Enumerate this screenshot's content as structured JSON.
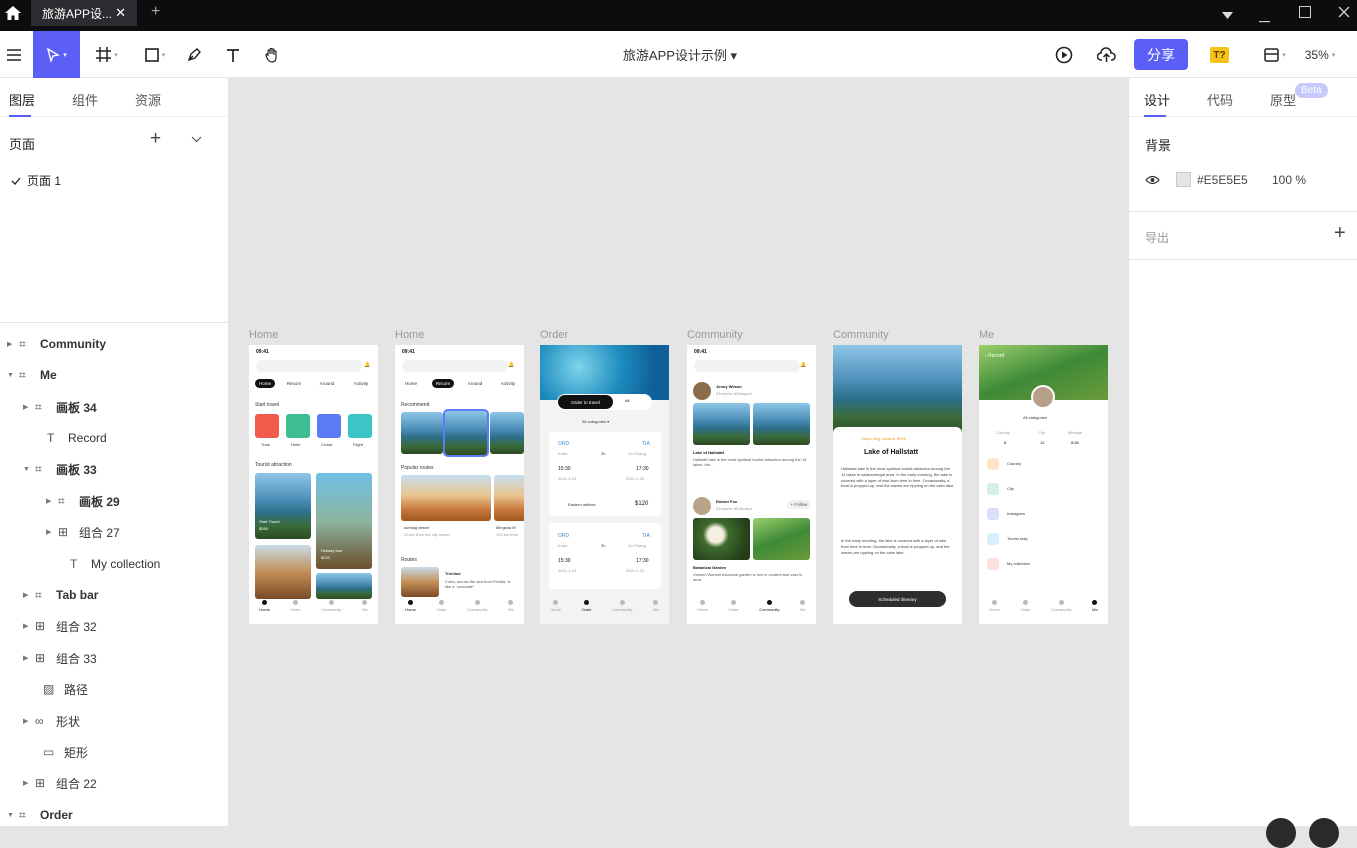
{
  "titlebar": {
    "tab_title": "旅游APP设...",
    "close": "✕",
    "new_tab": "+"
  },
  "toolbar": {
    "doc_title": "旅游APP设计示例 ▾",
    "share": "分享",
    "plugin": "T?",
    "zoom": "35%"
  },
  "left": {
    "tabs": [
      "图层",
      "组件",
      "资源"
    ],
    "pages_title": "页面",
    "page_item": "页面 1",
    "layers": [
      {
        "label": "Community",
        "bold": true
      },
      {
        "label": "Me",
        "bold": true
      },
      {
        "label": "画板 34",
        "bold": true
      },
      {
        "label": "Record",
        "bold": false
      },
      {
        "label": "画板 33",
        "bold": true
      },
      {
        "label": "画板 29",
        "bold": true
      },
      {
        "label": "组合 27",
        "bold": false
      },
      {
        "label": "My collection",
        "bold": false
      },
      {
        "label": "Tab bar",
        "bold": true
      },
      {
        "label": "组合 32",
        "bold": false
      },
      {
        "label": "组合 33",
        "bold": false
      },
      {
        "label": "路径",
        "bold": false
      },
      {
        "label": "形状",
        "bold": false
      },
      {
        "label": "矩形",
        "bold": false
      },
      {
        "label": "组合 22",
        "bold": false
      },
      {
        "label": "Order",
        "bold": true
      }
    ]
  },
  "right": {
    "tabs": [
      "设计",
      "代码",
      "原型"
    ],
    "beta": "Beta",
    "background_title": "背景",
    "bg_hex": "#E5E5E5",
    "bg_opacity": "100 %",
    "export_title": "导出"
  },
  "frames": {
    "labels": [
      "Home",
      "Home",
      "Order",
      "Community",
      "Community",
      "Me"
    ],
    "time": "09:41",
    "home1": {
      "chips": [
        "Home",
        "Recom",
        "Around",
        "Activity"
      ],
      "start_travel": "Start travel",
      "modes": [
        "Train",
        "Hotel",
        "Cruise",
        "Flight"
      ],
      "tourist_attraction": "Tourist attraction",
      "card1": "Start Travel",
      "card1_price": "$260",
      "card2": "Holiday tour",
      "card2_price": "$220"
    },
    "home2": {
      "chips": [
        "Home",
        "Recom",
        "Around",
        "Activity"
      ],
      "recommend": "Recommend",
      "popular_routes": "Popular routes",
      "route1": "kumtag desert",
      "route1_sub": "20 km from the city center",
      "route2": "Mingsha M",
      "route2_sub": "100 km from",
      "routes": "Routes",
      "trinidad": "Trinidad",
      "trinidad_desc": "Cuba, across the sea from Florida, is like a \"crocodile\""
    },
    "order": {
      "tab_active": "Order to travel",
      "tab_all": "All",
      "categories": "All categories ▾",
      "from": "ORD",
      "to": "TIA",
      "from_city": "Krabi",
      "to_city": "Xo Chang",
      "dur": "2h",
      "dep": "15:30",
      "arr": "17:30",
      "date": "2021-2-23",
      "airline": "Eastern airlines",
      "price": "$120"
    },
    "community1": {
      "user1": "Jenny Wilson",
      "user1_tag": "#Traveler #Designer",
      "post1_title": "Lake of Hallstatt",
      "post1_desc": "Hallstatt lake is the most spiritual tourist attraction among the 14 lakes, the...",
      "user2": "Robert Fox",
      "user2_tag": "#Traveler #Educator",
      "follow": "+ Follow",
      "post2_title": "Botanical Garden",
      "post2_desc": "Xiamen Wanshi botanical garden is rich in content and vast in area."
    },
    "community2": {
      "tag": "7days long. Austria. $999",
      "title": "Lake of Hallstatt",
      "p1": "Hallstadt lake is the most spiritual tourist attraction among the 14 lakes in salzkamergut area. In the early morning, the lake is covered with a layer of mist from time to time. Occasionally, a boat is propped up, and the waves are rippling on the calm lake.",
      "p2": "In the early morning, the lake is covered with a layer of mist from time to time. Occasionally, a boat is propped up, and the waves are rippling on the calm lake.",
      "button": "Scheduled itinerary"
    },
    "me": {
      "back": "‹ Record",
      "categories": "All categories",
      "stats_labels": [
        "Country",
        "City",
        "Mileage"
      ],
      "stats_values": [
        "8",
        "12",
        "8.6K"
      ],
      "menu": [
        "Country",
        "City",
        "Instagram",
        "Tourist map",
        "My collection"
      ]
    },
    "tabbar": [
      "Home",
      "Order",
      "Community",
      "Me"
    ]
  },
  "colors": {
    "accent": "#5b5ff5",
    "canvas": "#e5e5e5",
    "titlebar": "#0d0d0f"
  }
}
